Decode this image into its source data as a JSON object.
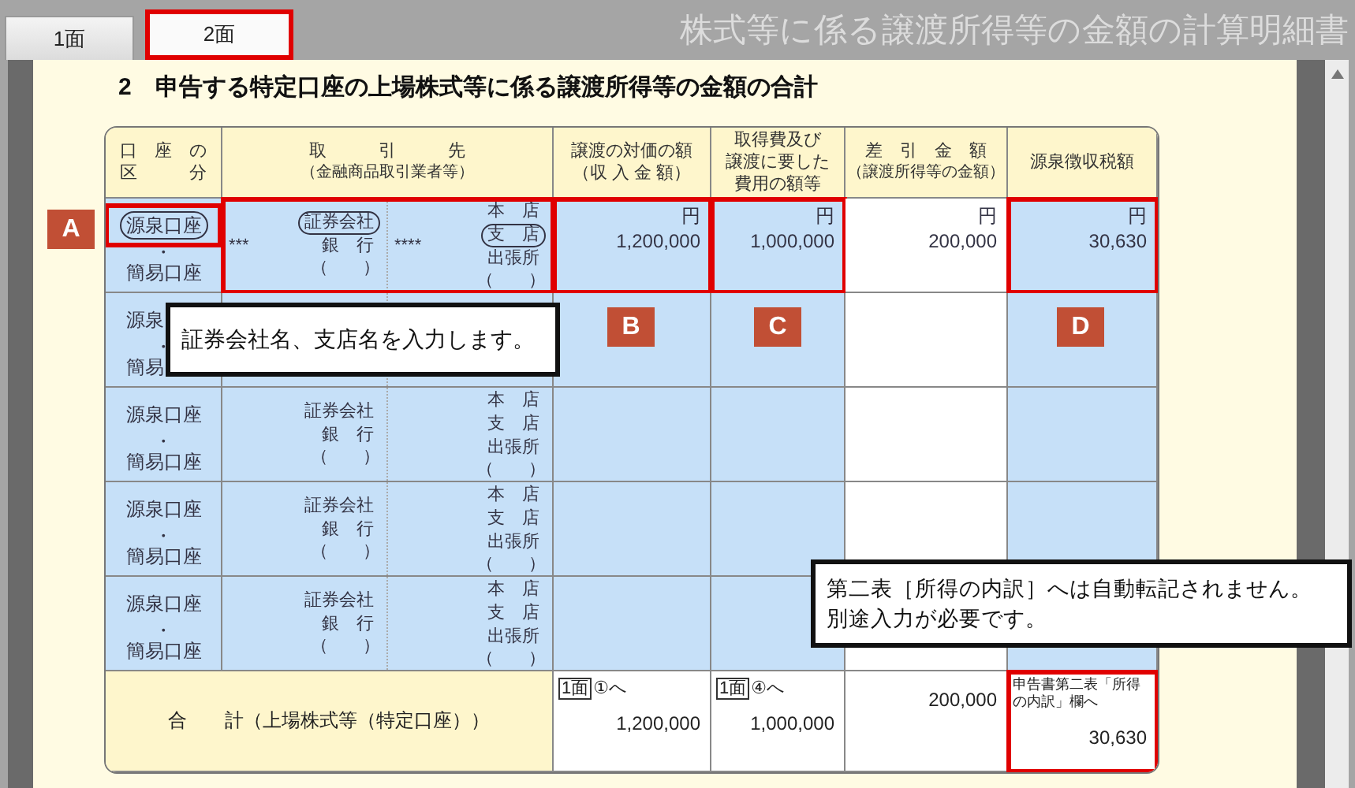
{
  "tabs": [
    {
      "label": "1面",
      "selected": false
    },
    {
      "label": "2面",
      "selected": true
    }
  ],
  "window": {
    "title": "株式等に係る譲渡所得等の金額の計算明細書"
  },
  "section": {
    "heading": "2　申告する特定口座の上場株式等に係る譲渡所得等の金額の合計"
  },
  "table": {
    "columns": [
      {
        "lines": [
          "口　座　の",
          "区　　　分"
        ]
      },
      {
        "lines": [
          "取　　　引　　　先"
        ],
        "subtitle": "（金融商品取引業者等）"
      },
      {
        "lines": [
          "譲渡の対価の額",
          "（収 入 金 額）"
        ]
      },
      {
        "lines": [
          "取得費及び",
          "譲渡に要した",
          "費用の額等"
        ]
      },
      {
        "lines": [
          "差　引　金　額"
        ],
        "subtitle": "（譲渡所得等の金額）"
      },
      {
        "lines": [
          "源泉徴収税額"
        ]
      }
    ],
    "rows": [
      {
        "account": {
          "options": [
            {
              "label": "源泉口座",
              "selected": true
            },
            {
              "label": "簡易口座",
              "selected": false
            }
          ],
          "separator": "・",
          "highlighted": true
        },
        "counterparty": {
          "highlighted": true,
          "company": {
            "name": "***",
            "types": [
              {
                "label": "証券会社",
                "selected": true
              },
              {
                "label": "銀　行",
                "selected": false
              }
            ],
            "paren": "（　　）"
          },
          "branch": {
            "name": "****",
            "types": [
              {
                "label": "本　店",
                "selected": false
              },
              {
                "label": "支　店",
                "selected": true
              },
              {
                "label": "出張所",
                "selected": false
              }
            ],
            "paren": "（　　）"
          }
        },
        "amounts": [
          {
            "unit": "円",
            "value": "1,200,000",
            "highlighted": true
          },
          {
            "unit": "円",
            "value": "1,000,000",
            "highlighted": true
          },
          {
            "unit": "円",
            "value": "200,000",
            "highlighted": false
          },
          {
            "unit": "円",
            "value": "30,630",
            "highlighted": true
          }
        ]
      },
      {
        "account": {
          "options": [
            {
              "label": "源泉",
              "selected": false
            },
            {
              "label": "簡易",
              "selected": false
            }
          ],
          "separator": "・",
          "highlighted": false
        }
      },
      {
        "account": {
          "options": [
            {
              "label": "源泉口座",
              "selected": false
            },
            {
              "label": "簡易口座",
              "selected": false
            }
          ],
          "separator": "・",
          "highlighted": false
        },
        "counterparty": {
          "highlighted": false,
          "company": {
            "types": [
              {
                "label": "証券会社",
                "selected": false
              },
              {
                "label": "銀　行",
                "selected": false
              }
            ],
            "paren": "（　　）"
          },
          "branch": {
            "types": [
              {
                "label": "本　店",
                "selected": false
              },
              {
                "label": "支　店",
                "selected": false
              },
              {
                "label": "出張所",
                "selected": false
              }
            ],
            "paren": "（　　）"
          }
        }
      },
      {
        "account": {
          "options": [
            {
              "label": "源泉口座",
              "selected": false
            },
            {
              "label": "簡易口座",
              "selected": false
            }
          ],
          "separator": "・",
          "highlighted": false
        },
        "counterparty": {
          "highlighted": false,
          "company": {
            "types": [
              {
                "label": "証券会社",
                "selected": false
              },
              {
                "label": "銀　行",
                "selected": false
              }
            ],
            "paren": "（　　）"
          },
          "branch": {
            "types": [
              {
                "label": "本　店",
                "selected": false
              },
              {
                "label": "支　店",
                "selected": false
              },
              {
                "label": "出張所",
                "selected": false
              }
            ],
            "paren": "（　　）"
          }
        }
      },
      {
        "account": {
          "options": [
            {
              "label": "源泉口座",
              "selected": false
            },
            {
              "label": "簡易口座",
              "selected": false
            }
          ],
          "separator": "・",
          "highlighted": false
        },
        "counterparty": {
          "highlighted": false,
          "company": {
            "types": [
              {
                "label": "証券会社",
                "selected": false
              },
              {
                "label": "銀　行",
                "selected": false
              }
            ],
            "paren": "（　　）"
          },
          "branch": {
            "types": [
              {
                "label": "本　店",
                "selected": false
              },
              {
                "label": "支　店",
                "selected": false
              },
              {
                "label": "出張所",
                "selected": false
              }
            ],
            "paren": "（　　）"
          }
        }
      }
    ],
    "total": {
      "label": "合　　計（上場株式等（特定口座））",
      "cells": [
        {
          "ref_box": "1面",
          "ref_text": "①へ",
          "value": "1,200,000",
          "highlighted": false
        },
        {
          "ref_box": "1面",
          "ref_text": "④へ",
          "value": "1,000,000",
          "highlighted": false
        },
        {
          "value": "200,000",
          "highlighted": false
        },
        {
          "note": "申告書第二表「所得の内訳」欄へ",
          "value": "30,630",
          "highlighted": true
        }
      ]
    }
  },
  "markers": [
    {
      "label": "A"
    },
    {
      "label": "B"
    },
    {
      "label": "C"
    },
    {
      "label": "D"
    }
  ],
  "callouts": [
    {
      "lines": [
        "証券会社名、支店名を入力します。"
      ]
    },
    {
      "lines": [
        "第二表［所得の内訳］へは自動転記されません。",
        "別途入力が必要です。"
      ]
    }
  ]
}
